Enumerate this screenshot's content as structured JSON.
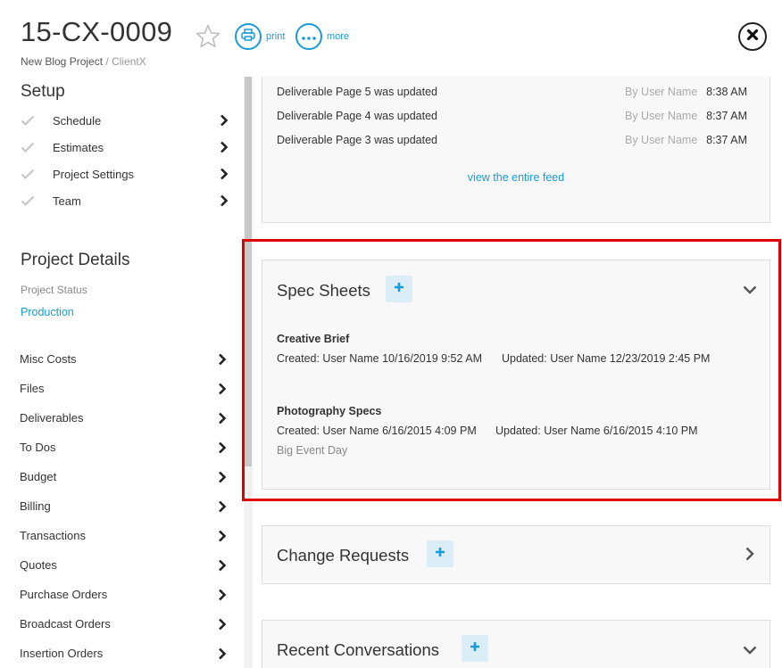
{
  "header": {
    "project_id": "15-CX-0009",
    "print_label": "print",
    "more_label": "more",
    "breadcrumb": {
      "project": "New Blog Project",
      "separator": "/",
      "client": "ClientX"
    }
  },
  "sidebar": {
    "setup_title": "Setup",
    "setup_items": [
      {
        "label": "Schedule"
      },
      {
        "label": "Estimates"
      },
      {
        "label": "Project Settings"
      },
      {
        "label": "Team"
      }
    ],
    "details_title": "Project Details",
    "status_label": "Project Status",
    "status_value": "Production",
    "nav_items": [
      {
        "label": "Misc Costs"
      },
      {
        "label": "Files"
      },
      {
        "label": "Deliverables"
      },
      {
        "label": "To Dos"
      },
      {
        "label": "Budget"
      },
      {
        "label": "Billing"
      },
      {
        "label": "Transactions"
      },
      {
        "label": "Quotes"
      },
      {
        "label": "Purchase Orders"
      },
      {
        "label": "Broadcast Orders"
      },
      {
        "label": "Insertion Orders"
      }
    ]
  },
  "feed": {
    "rows": [
      {
        "text": "Deliverable Page 5 was updated",
        "by": "By User Name",
        "time": "8:38 AM"
      },
      {
        "text": "Deliverable Page 4 was updated",
        "by": "By User Name",
        "time": "8:37 AM"
      },
      {
        "text": "Deliverable Page 3 was updated",
        "by": "By User Name",
        "time": "8:37 AM"
      }
    ],
    "link": "view the entire feed"
  },
  "spec_sheets": {
    "title": "Spec Sheets",
    "items": [
      {
        "name": "Creative Brief",
        "created": "Created: User Name 10/16/2019 9:52 AM",
        "updated": "Updated: User Name 12/23/2019 2:45 PM",
        "note": ""
      },
      {
        "name": "Photography Specs",
        "created": "Created: User Name 6/16/2015 4:09 PM",
        "updated": "Updated: User Name 6/16/2015 4:10 PM",
        "note": "Big Event Day"
      }
    ]
  },
  "change_requests": {
    "title": "Change Requests"
  },
  "recent_conversations": {
    "title": "Recent Conversations"
  },
  "colors": {
    "accent": "#1a9bd7",
    "highlight": "#e10000",
    "panel_bg": "#f8f8f8",
    "add_bg": "#dbeef8"
  },
  "icons": [
    "star-icon",
    "print-icon",
    "more-icon",
    "close-icon",
    "check-icon",
    "chevron-right-icon",
    "chevron-down-icon",
    "plus-icon"
  ]
}
